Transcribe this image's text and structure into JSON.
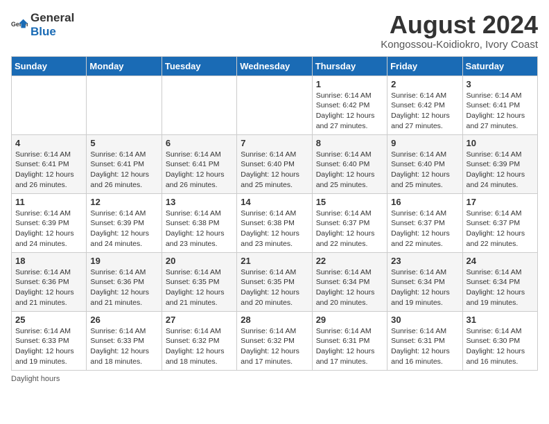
{
  "header": {
    "logo_general": "General",
    "logo_blue": "Blue",
    "title": "August 2024",
    "subtitle": "Kongossou-Koidiokro, Ivory Coast"
  },
  "days_of_week": [
    "Sunday",
    "Monday",
    "Tuesday",
    "Wednesday",
    "Thursday",
    "Friday",
    "Saturday"
  ],
  "weeks": [
    [
      {
        "day": "",
        "info": ""
      },
      {
        "day": "",
        "info": ""
      },
      {
        "day": "",
        "info": ""
      },
      {
        "day": "",
        "info": ""
      },
      {
        "day": "1",
        "info": "Sunrise: 6:14 AM\nSunset: 6:42 PM\nDaylight: 12 hours\nand 27 minutes."
      },
      {
        "day": "2",
        "info": "Sunrise: 6:14 AM\nSunset: 6:42 PM\nDaylight: 12 hours\nand 27 minutes."
      },
      {
        "day": "3",
        "info": "Sunrise: 6:14 AM\nSunset: 6:41 PM\nDaylight: 12 hours\nand 27 minutes."
      }
    ],
    [
      {
        "day": "4",
        "info": "Sunrise: 6:14 AM\nSunset: 6:41 PM\nDaylight: 12 hours\nand 26 minutes."
      },
      {
        "day": "5",
        "info": "Sunrise: 6:14 AM\nSunset: 6:41 PM\nDaylight: 12 hours\nand 26 minutes."
      },
      {
        "day": "6",
        "info": "Sunrise: 6:14 AM\nSunset: 6:41 PM\nDaylight: 12 hours\nand 26 minutes."
      },
      {
        "day": "7",
        "info": "Sunrise: 6:14 AM\nSunset: 6:40 PM\nDaylight: 12 hours\nand 25 minutes."
      },
      {
        "day": "8",
        "info": "Sunrise: 6:14 AM\nSunset: 6:40 PM\nDaylight: 12 hours\nand 25 minutes."
      },
      {
        "day": "9",
        "info": "Sunrise: 6:14 AM\nSunset: 6:40 PM\nDaylight: 12 hours\nand 25 minutes."
      },
      {
        "day": "10",
        "info": "Sunrise: 6:14 AM\nSunset: 6:39 PM\nDaylight: 12 hours\nand 24 minutes."
      }
    ],
    [
      {
        "day": "11",
        "info": "Sunrise: 6:14 AM\nSunset: 6:39 PM\nDaylight: 12 hours\nand 24 minutes."
      },
      {
        "day": "12",
        "info": "Sunrise: 6:14 AM\nSunset: 6:39 PM\nDaylight: 12 hours\nand 24 minutes."
      },
      {
        "day": "13",
        "info": "Sunrise: 6:14 AM\nSunset: 6:38 PM\nDaylight: 12 hours\nand 23 minutes."
      },
      {
        "day": "14",
        "info": "Sunrise: 6:14 AM\nSunset: 6:38 PM\nDaylight: 12 hours\nand 23 minutes."
      },
      {
        "day": "15",
        "info": "Sunrise: 6:14 AM\nSunset: 6:37 PM\nDaylight: 12 hours\nand 22 minutes."
      },
      {
        "day": "16",
        "info": "Sunrise: 6:14 AM\nSunset: 6:37 PM\nDaylight: 12 hours\nand 22 minutes."
      },
      {
        "day": "17",
        "info": "Sunrise: 6:14 AM\nSunset: 6:37 PM\nDaylight: 12 hours\nand 22 minutes."
      }
    ],
    [
      {
        "day": "18",
        "info": "Sunrise: 6:14 AM\nSunset: 6:36 PM\nDaylight: 12 hours\nand 21 minutes."
      },
      {
        "day": "19",
        "info": "Sunrise: 6:14 AM\nSunset: 6:36 PM\nDaylight: 12 hours\nand 21 minutes."
      },
      {
        "day": "20",
        "info": "Sunrise: 6:14 AM\nSunset: 6:35 PM\nDaylight: 12 hours\nand 21 minutes."
      },
      {
        "day": "21",
        "info": "Sunrise: 6:14 AM\nSunset: 6:35 PM\nDaylight: 12 hours\nand 20 minutes."
      },
      {
        "day": "22",
        "info": "Sunrise: 6:14 AM\nSunset: 6:34 PM\nDaylight: 12 hours\nand 20 minutes."
      },
      {
        "day": "23",
        "info": "Sunrise: 6:14 AM\nSunset: 6:34 PM\nDaylight: 12 hours\nand 19 minutes."
      },
      {
        "day": "24",
        "info": "Sunrise: 6:14 AM\nSunset: 6:34 PM\nDaylight: 12 hours\nand 19 minutes."
      }
    ],
    [
      {
        "day": "25",
        "info": "Sunrise: 6:14 AM\nSunset: 6:33 PM\nDaylight: 12 hours\nand 19 minutes."
      },
      {
        "day": "26",
        "info": "Sunrise: 6:14 AM\nSunset: 6:33 PM\nDaylight: 12 hours\nand 18 minutes."
      },
      {
        "day": "27",
        "info": "Sunrise: 6:14 AM\nSunset: 6:32 PM\nDaylight: 12 hours\nand 18 minutes."
      },
      {
        "day": "28",
        "info": "Sunrise: 6:14 AM\nSunset: 6:32 PM\nDaylight: 12 hours\nand 17 minutes."
      },
      {
        "day": "29",
        "info": "Sunrise: 6:14 AM\nSunset: 6:31 PM\nDaylight: 12 hours\nand 17 minutes."
      },
      {
        "day": "30",
        "info": "Sunrise: 6:14 AM\nSunset: 6:31 PM\nDaylight: 12 hours\nand 16 minutes."
      },
      {
        "day": "31",
        "info": "Sunrise: 6:14 AM\nSunset: 6:30 PM\nDaylight: 12 hours\nand 16 minutes."
      }
    ]
  ],
  "footer": {
    "note": "Daylight hours"
  }
}
